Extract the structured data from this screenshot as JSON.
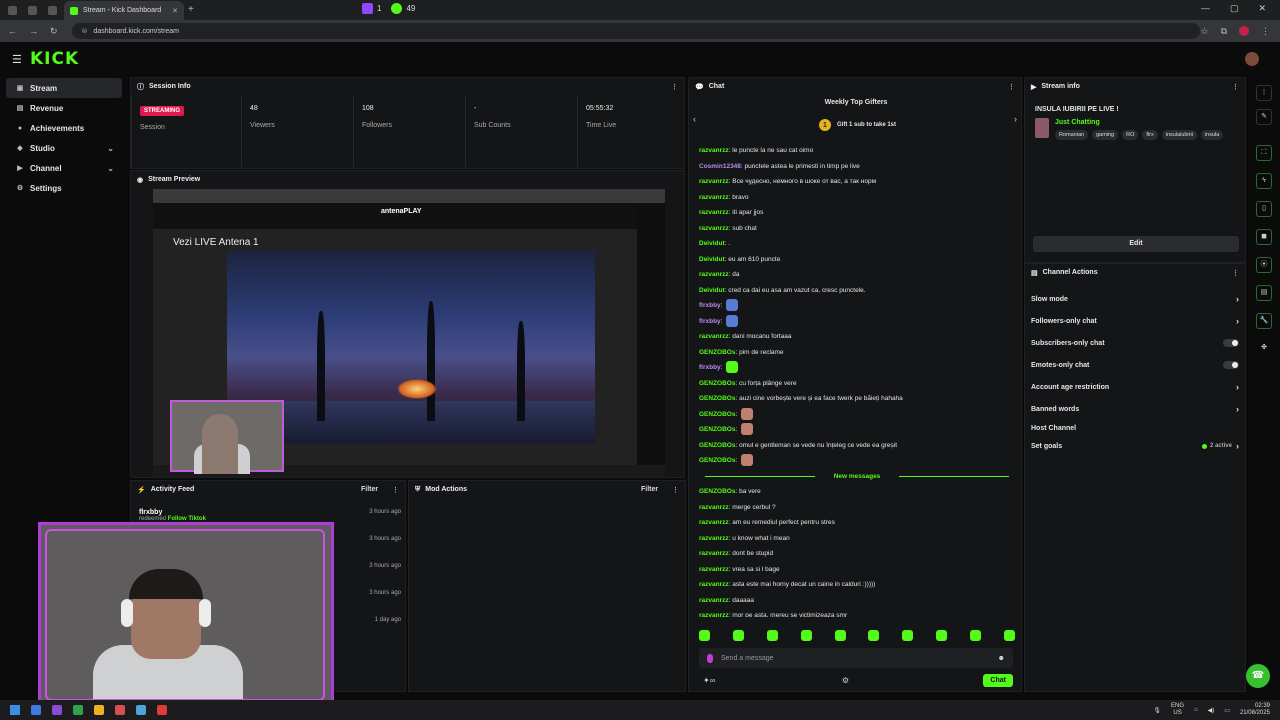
{
  "browser": {
    "tab_title": "Stream - Kick Dashboard",
    "url": "dashboard.kick.com/stream",
    "twitch_count": "1",
    "kick_count": "49"
  },
  "app": {
    "logo": "KICK"
  },
  "sidebar": {
    "items": [
      {
        "label": "Stream",
        "icon": "stream-icon",
        "active": true
      },
      {
        "label": "Revenue",
        "icon": "revenue-icon"
      },
      {
        "label": "Achievements",
        "icon": "achievements-icon"
      },
      {
        "label": "Studio",
        "icon": "studio-icon",
        "expandable": true
      },
      {
        "label": "Channel",
        "icon": "channel-icon",
        "expandable": true
      },
      {
        "label": "Settings",
        "icon": "settings-icon"
      }
    ]
  },
  "session": {
    "title": "Session Info",
    "status_badge": "STREAMING",
    "status_label": "Session",
    "stats": [
      {
        "value": "48",
        "label": "Viewers"
      },
      {
        "value": "108",
        "label": "Followers"
      },
      {
        "value": "-",
        "label": "Sub Counts"
      },
      {
        "value": "05:55:32",
        "label": "Time Live"
      }
    ]
  },
  "preview": {
    "title": "Stream Preview",
    "site_logo": "antenaPLAY",
    "page_heading": "Vezi LIVE Antena 1"
  },
  "activity": {
    "title": "Activity Feed",
    "filter_label": "Filter",
    "items": [
      {
        "name": "flrxbby",
        "action": "redeemed",
        "reward": "Follow Tiktok",
        "time": "3 hours ago"
      },
      {
        "time": "3 hours ago"
      },
      {
        "time": "3 hours ago"
      },
      {
        "time": "3 hours ago"
      },
      {
        "time": "1 day ago"
      }
    ]
  },
  "mod_actions": {
    "title": "Mod Actions",
    "filter_label": "Filter"
  },
  "chat": {
    "title": "Chat",
    "top_gifters_title": "Weekly Top Gifters",
    "gift_prompt": "Gift 1 sub to take 1st",
    "messages": [
      {
        "user": "razvanrzz",
        "color": "#53fc18",
        "text": "le puncte la ne sau cat oimo"
      },
      {
        "user": "Cosmin12348",
        "color": "#b98cf0",
        "text": "punctele astea le primesti in timp pe live"
      },
      {
        "user": "razvanrzz",
        "color": "#53fc18",
        "text": "Все чудесно, немного в шоке от вас, а так норм"
      },
      {
        "user": "razvanrzz",
        "color": "#53fc18",
        "text": "bravo"
      },
      {
        "user": "razvanrzz",
        "color": "#53fc18",
        "text": "iti apar jjos"
      },
      {
        "user": "razvanrzz",
        "color": "#53fc18",
        "text": "sub chat"
      },
      {
        "user": "Deividut",
        "color": "#53fc18",
        "text": "."
      },
      {
        "user": "Deividut",
        "color": "#53fc18",
        "text": "eu am 610 puncte"
      },
      {
        "user": "razvanrzz",
        "color": "#53fc18",
        "text": "da"
      },
      {
        "user": "Deividut",
        "color": "#53fc18",
        "text": "cred ca dai eu asa am vazut ca, cresc punctele."
      },
      {
        "user": "flrxbby",
        "color": "#b98cf0",
        "text": "",
        "emote": "#5a7bd6"
      },
      {
        "user": "flrxbby",
        "color": "#b98cf0",
        "text": "",
        "emote": "#5a7bd6"
      },
      {
        "user": "razvanrzz",
        "color": "#53fc18",
        "text": "dani mocanu fortaaa"
      },
      {
        "user": "GENZOBOs",
        "color": "#53fc18",
        "text": "pim de reclame"
      },
      {
        "user": "flrxbby",
        "color": "#b98cf0",
        "text": "",
        "emote": "#53fc18"
      },
      {
        "user": "GENZOBOs",
        "color": "#53fc18",
        "text": "cu forța plânge vere"
      },
      {
        "user": "GENZOBOs",
        "color": "#53fc18",
        "text": "auzi cine vorbește vere și ea face twerk pe băieți hahaha"
      },
      {
        "user": "GENZOBOs",
        "color": "#53fc18",
        "text": "",
        "emote": "#c08070"
      },
      {
        "user": "GENZOBOs",
        "color": "#53fc18",
        "text": "",
        "emote": "#c08070"
      },
      {
        "user": "GENZOBOs",
        "color": "#53fc18",
        "text": "omul e gentleman se vede nu înțeleg ce vede ea greșit"
      },
      {
        "user": "GENZOBOs",
        "color": "#53fc18",
        "text": "",
        "emote": "#c08070"
      },
      {
        "new_marker": "New messages"
      },
      {
        "user": "GENZOBOs",
        "color": "#53fc18",
        "text": "ba vere"
      },
      {
        "user": "razvanrzz",
        "color": "#53fc18",
        "text": "merge cerbul ?"
      },
      {
        "user": "razvanrzz",
        "color": "#53fc18",
        "text": "am eu remediul perfect pentru stres"
      },
      {
        "user": "razvanrzz",
        "color": "#53fc18",
        "text": "u know what i mean"
      },
      {
        "user": "razvanrzz",
        "color": "#53fc18",
        "text": "dont be stupid"
      },
      {
        "user": "razvanrzz",
        "color": "#53fc18",
        "text": "vrea sa si l bage"
      },
      {
        "user": "razvanrzz",
        "color": "#53fc18",
        "text": "asta este mai horny decat un caine in calduri :)))))"
      },
      {
        "user": "razvanrzz",
        "color": "#53fc18",
        "text": "daaaaa"
      },
      {
        "user": "razvanrzz",
        "color": "#53fc18",
        "text": "mor pe asta. mereu se victimizeaza smr"
      }
    ],
    "input_placeholder": "Send a message",
    "send_label": "Chat"
  },
  "stream_info": {
    "title": "Stream info",
    "stream_title": "INSULA IUBIRII PE LIVE !",
    "category": "Just Chatting",
    "tags": [
      "Romanian",
      "gaming",
      "RO",
      "flrx",
      "insulaiubirii",
      "insula"
    ],
    "edit_label": "Edit"
  },
  "channel_actions": {
    "title": "Channel Actions",
    "items": [
      {
        "label": "Slow mode",
        "kind": "arrow"
      },
      {
        "label": "Followers-only chat",
        "kind": "arrow"
      },
      {
        "label": "Subscribers-only chat",
        "kind": "toggle"
      },
      {
        "label": "Emotes-only chat",
        "kind": "toggle"
      },
      {
        "label": "Account age restriction",
        "kind": "arrow"
      },
      {
        "label": "Banned words",
        "kind": "arrow"
      },
      {
        "label": "Host Channel",
        "kind": "none"
      },
      {
        "label": "Set goals",
        "kind": "active",
        "status": "2 active"
      }
    ]
  },
  "taskbar": {
    "lang": "ENG",
    "region": "US",
    "time": "02:39",
    "date": "21/08/2025"
  }
}
